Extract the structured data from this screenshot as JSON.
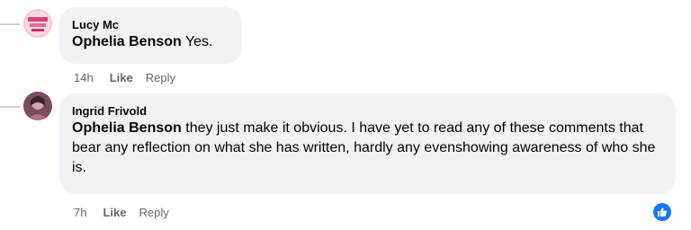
{
  "comments": [
    {
      "author": "Lucy Mc",
      "mention": "Ophelia Benson",
      "text": " Yes.",
      "time": "14h",
      "like_label": "Like",
      "reply_label": "Reply"
    },
    {
      "author": "Ingrid Frivold",
      "mention": "Ophelia Benson",
      "text": " they just make it obvious. I have yet to read any of these comments that bear any reflection on what she has written, hardly any evenshowing awareness of who she is.",
      "time": "7h",
      "like_label": "Like",
      "reply_label": "Reply",
      "reaction_icon": "thumbs-up-icon"
    }
  ],
  "colors": {
    "bubble": "#f0f2f5",
    "meta": "#65676b",
    "like_reaction": "#1877f2"
  }
}
